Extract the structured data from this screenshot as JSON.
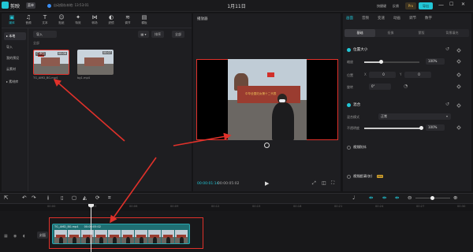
{
  "titlebar": {
    "app_name": "剪映",
    "menu_label": "菜单",
    "save_status": "自动保存本地: 13:53:01",
    "project_title": "1月11日",
    "shortcut": "快捷键",
    "feedback": "反馈",
    "pro_label": "Pro",
    "export_label": "导出",
    "win_min": "—",
    "win_max": "☐",
    "win_close": "✕"
  },
  "tool_tabs": [
    {
      "label": "媒体",
      "icon": "media-icon",
      "glyph": "▣"
    },
    {
      "label": "音频",
      "icon": "audio-icon",
      "glyph": "♫"
    },
    {
      "label": "文本",
      "icon": "text-icon",
      "glyph": "T"
    },
    {
      "label": "贴纸",
      "icon": "sticker-icon",
      "glyph": "☺"
    },
    {
      "label": "特效",
      "icon": "effects-icon",
      "glyph": "✦"
    },
    {
      "label": "转场",
      "icon": "transition-icon",
      "glyph": "⋈"
    },
    {
      "label": "滤镜",
      "icon": "filter-icon",
      "glyph": "◐"
    },
    {
      "label": "调节",
      "icon": "adjust-icon",
      "glyph": "≋"
    },
    {
      "label": "模板",
      "icon": "template-icon",
      "glyph": "▤"
    }
  ],
  "sidebar": {
    "items": [
      {
        "label": "▸ 本地"
      },
      {
        "label": "导入"
      },
      {
        "label": "我的预设"
      },
      {
        "label": "云素材"
      },
      {
        "label": "▸ 素材库"
      }
    ]
  },
  "media": {
    "import_label": "导入",
    "sort_label": "排序",
    "filter_label": "全部",
    "view_label": "▦ ▾",
    "group_label": "全部",
    "thumbs": [
      {
        "badge": "已添加",
        "duration": "00:06",
        "name": "TG_AMD_BG.mp4"
      },
      {
        "badge": "",
        "duration": "00:07",
        "name": "bg1.mp4"
      }
    ]
  },
  "player": {
    "title": "播放器",
    "banner_text": "中华全国妇女第十二代表",
    "time_current": "00:00:01:14",
    "time_total": "00:00:05:02",
    "play_glyph": "▶",
    "fullscreen_glyph": "⛶",
    "ratio_glyph": "◫",
    "crop_glyph": "⤢"
  },
  "props": {
    "tabs": [
      "画面",
      "音频",
      "变速",
      "动画",
      "调节",
      "数字"
    ],
    "subtabs": [
      "基础",
      "抠像",
      "蒙版",
      "背景填充"
    ],
    "position_section": "位置大小",
    "scale_label": "缩放",
    "scale_value": "100%",
    "position_label": "位置",
    "pos_x": "0",
    "pos_y": "0",
    "rotate_label": "旋转",
    "rotate_value": "0°",
    "blend_section": "混合",
    "blend_mode_label": "混合模式",
    "blend_mode_value": "正常",
    "opacity_label": "不透明度",
    "opacity_value": "100%",
    "stabilize_label": "视频防抖",
    "enhance_label": "视频超清(仅)",
    "pro_badge": "PRO",
    "scale_fraction": 0.3,
    "opacity_fraction": 1.0
  },
  "timeline": {
    "ruler_ticks": [
      "00:00",
      "00:03",
      "00:06",
      "00:09",
      "00:12",
      "00:15",
      "00:18",
      "00:21",
      "00:24",
      "00:27",
      "00:30"
    ],
    "clip_name": "TG_AMD_BG.mp4",
    "clip_duration": "00:00:05:02",
    "cover_label": "封面"
  },
  "colors": {
    "accent": "#22c6d6",
    "annotation_red": "#e0312a",
    "clip_fill": "#1f6f73"
  }
}
